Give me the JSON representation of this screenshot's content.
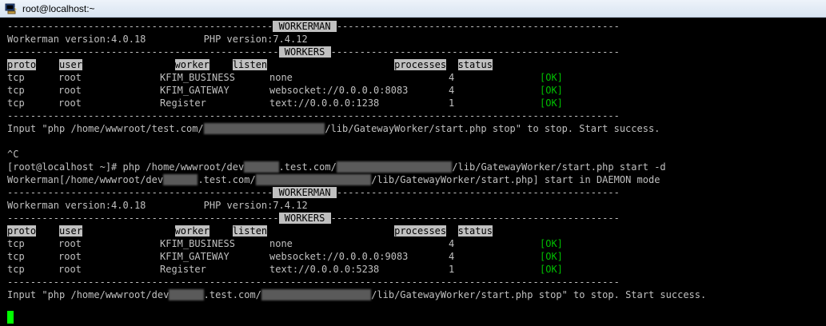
{
  "window": {
    "title": "root@localhost:~"
  },
  "terminal": {
    "banner1": {
      "left": "----------------------------------------------",
      "label": " WORKERMAN ",
      "right": "-------------------------------------------------"
    },
    "version1": "Workerman version:4.0.18          PHP version:7.4.12",
    "workers1": {
      "left": "-----------------------------------------------",
      "label": " WORKERS ",
      "right": "--------------------------------------------------"
    },
    "headers": {
      "proto": "proto",
      "user": "user",
      "worker": "worker",
      "listen": "listen",
      "processes": "processes",
      "status": "status"
    },
    "gap": {
      "g1": "    ",
      "g2": "                ",
      "g3": "    ",
      "g4": "                      ",
      "g5": "  "
    },
    "rows1": [
      {
        "proto": "tcp",
        "user": "root",
        "worker": "KFIM_BUSINESS",
        "listen": "none",
        "processes": "4",
        "status": "[OK]"
      },
      {
        "proto": "tcp",
        "user": "root",
        "worker": "KFIM_GATEWAY",
        "listen": "websocket://0.0.0.0:8083",
        "processes": "4",
        "status": "[OK]"
      },
      {
        "proto": "tcp",
        "user": "root",
        "worker": "Register",
        "listen": "text://0.0.0.0:1238",
        "processes": "1",
        "status": "[OK]"
      }
    ],
    "sep1": "----------------------------------------------------------------------------------------------------------",
    "input1": {
      "a": "Input \"php /home/wwwroot/test.com/",
      "hidden": "xxxxxxxxxxxxxxxxxxxxx",
      "b": "/lib/GatewayWorker/start.php stop\" to stop. Start success."
    },
    "ctrlc": "^C",
    "cmd": {
      "a": "[root@localhost ~]# php /home/wwwroot/dev",
      "h1": "xxxxxx",
      "b": ".test.com/",
      "h2": "xxxxxxxxxxxxxxxxxxxx",
      "c": "/lib/GatewayWorker/start.php start -d"
    },
    "daemon": {
      "a": "Workerman[/home/wwwroot/dev",
      "h1": "xxxxxx",
      "b": ".test.com/",
      "h2": "xxxxxxxxxxxxxxxxxxxx",
      "c": "/lib/GatewayWorker/start.php] start in DAEMON mode"
    },
    "banner2": {
      "left": "----------------------------------------------",
      "label": " WORKERMAN ",
      "right": "-------------------------------------------------"
    },
    "version2": "Workerman version:4.0.18          PHP version:7.4.12",
    "workers2": {
      "left": "-----------------------------------------------",
      "label": " WORKERS ",
      "right": "--------------------------------------------------"
    },
    "rows2": [
      {
        "proto": "tcp",
        "user": "root",
        "worker": "KFIM_BUSINESS",
        "listen": "none",
        "processes": "4",
        "status": "[OK]"
      },
      {
        "proto": "tcp",
        "user": "root",
        "worker": "KFIM_GATEWAY",
        "listen": "websocket://0.0.0.0:9083",
        "processes": "4",
        "status": "[OK]"
      },
      {
        "proto": "tcp",
        "user": "root",
        "worker": "Register",
        "listen": "text://0.0.0.0:5238",
        "processes": "1",
        "status": "[OK]"
      }
    ],
    "sep2": "----------------------------------------------------------------------------------------------------------",
    "input2": {
      "a": "Input \"php /home/wwwroot/dev",
      "h1": "xxxxxx",
      "b": ".test.com/",
      "h2": "xxxxxxxxxxxxxxxxxxx",
      "c": "/lib/GatewayWorker/start.php stop\" to stop. Start success."
    }
  }
}
